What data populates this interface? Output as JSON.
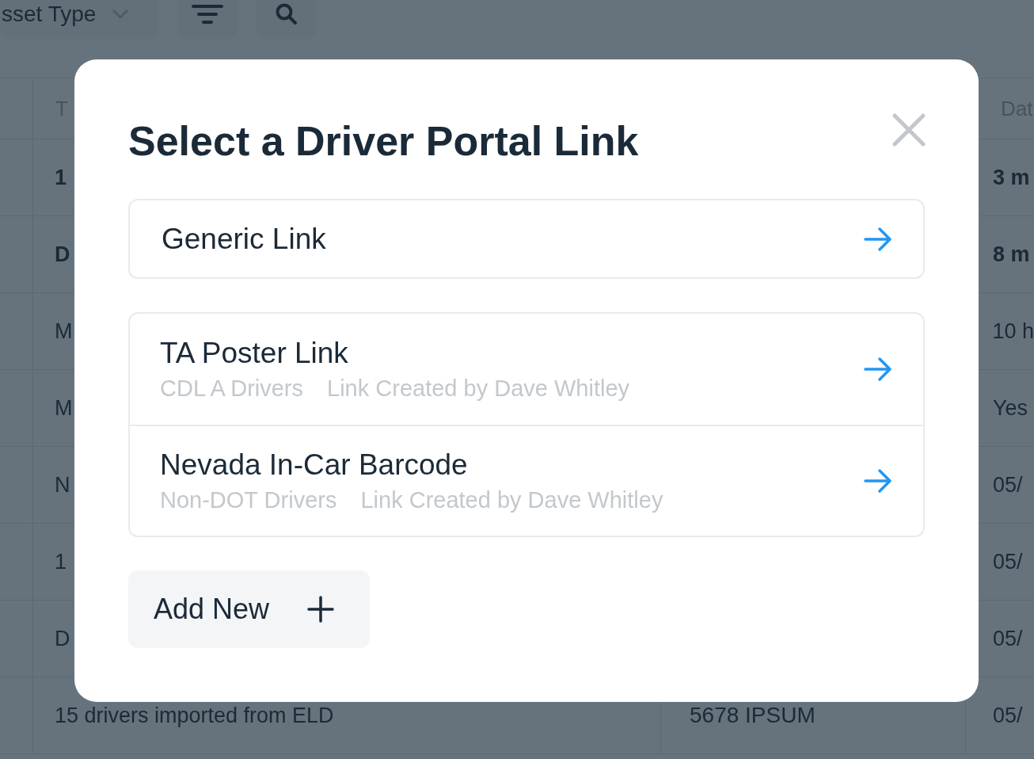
{
  "toolbar": {
    "asset_type_dropdown": "sset Type"
  },
  "table": {
    "columns": [
      "T",
      "Dat"
    ],
    "rows": [
      {
        "column_1": "1",
        "column_3": "3 m",
        "unread": true
      },
      {
        "column_1": "D",
        "column_3": "8 m",
        "unread": true
      },
      {
        "column_1": "M",
        "column_3": "10 h",
        "unread": false
      },
      {
        "column_1": "M",
        "column_3": "Yes",
        "unread": false
      },
      {
        "column_1": "N",
        "column_3": "05/",
        "unread": false
      },
      {
        "column_1": "1",
        "column_3": "05/",
        "unread": false
      },
      {
        "column_1": "D",
        "column_3": "05/",
        "unread": false
      },
      {
        "column_1": "15 drivers imported from ELD",
        "column_2": "5678 IPSUM",
        "column_3": "05/",
        "unread": false
      }
    ]
  },
  "modal": {
    "title": "Select a Driver Portal Link",
    "generic_link": {
      "name": "Generic Link"
    },
    "saved_links": [
      {
        "name": "TA Poster Link",
        "group": "CDL A Drivers",
        "creator": "Link Created by Dave Whitley"
      },
      {
        "name": "Nevada In-Car Barcode",
        "group": "Non-DOT Drivers",
        "creator": "Link Created by Dave Whitley"
      }
    ],
    "add_button": "Add New"
  }
}
